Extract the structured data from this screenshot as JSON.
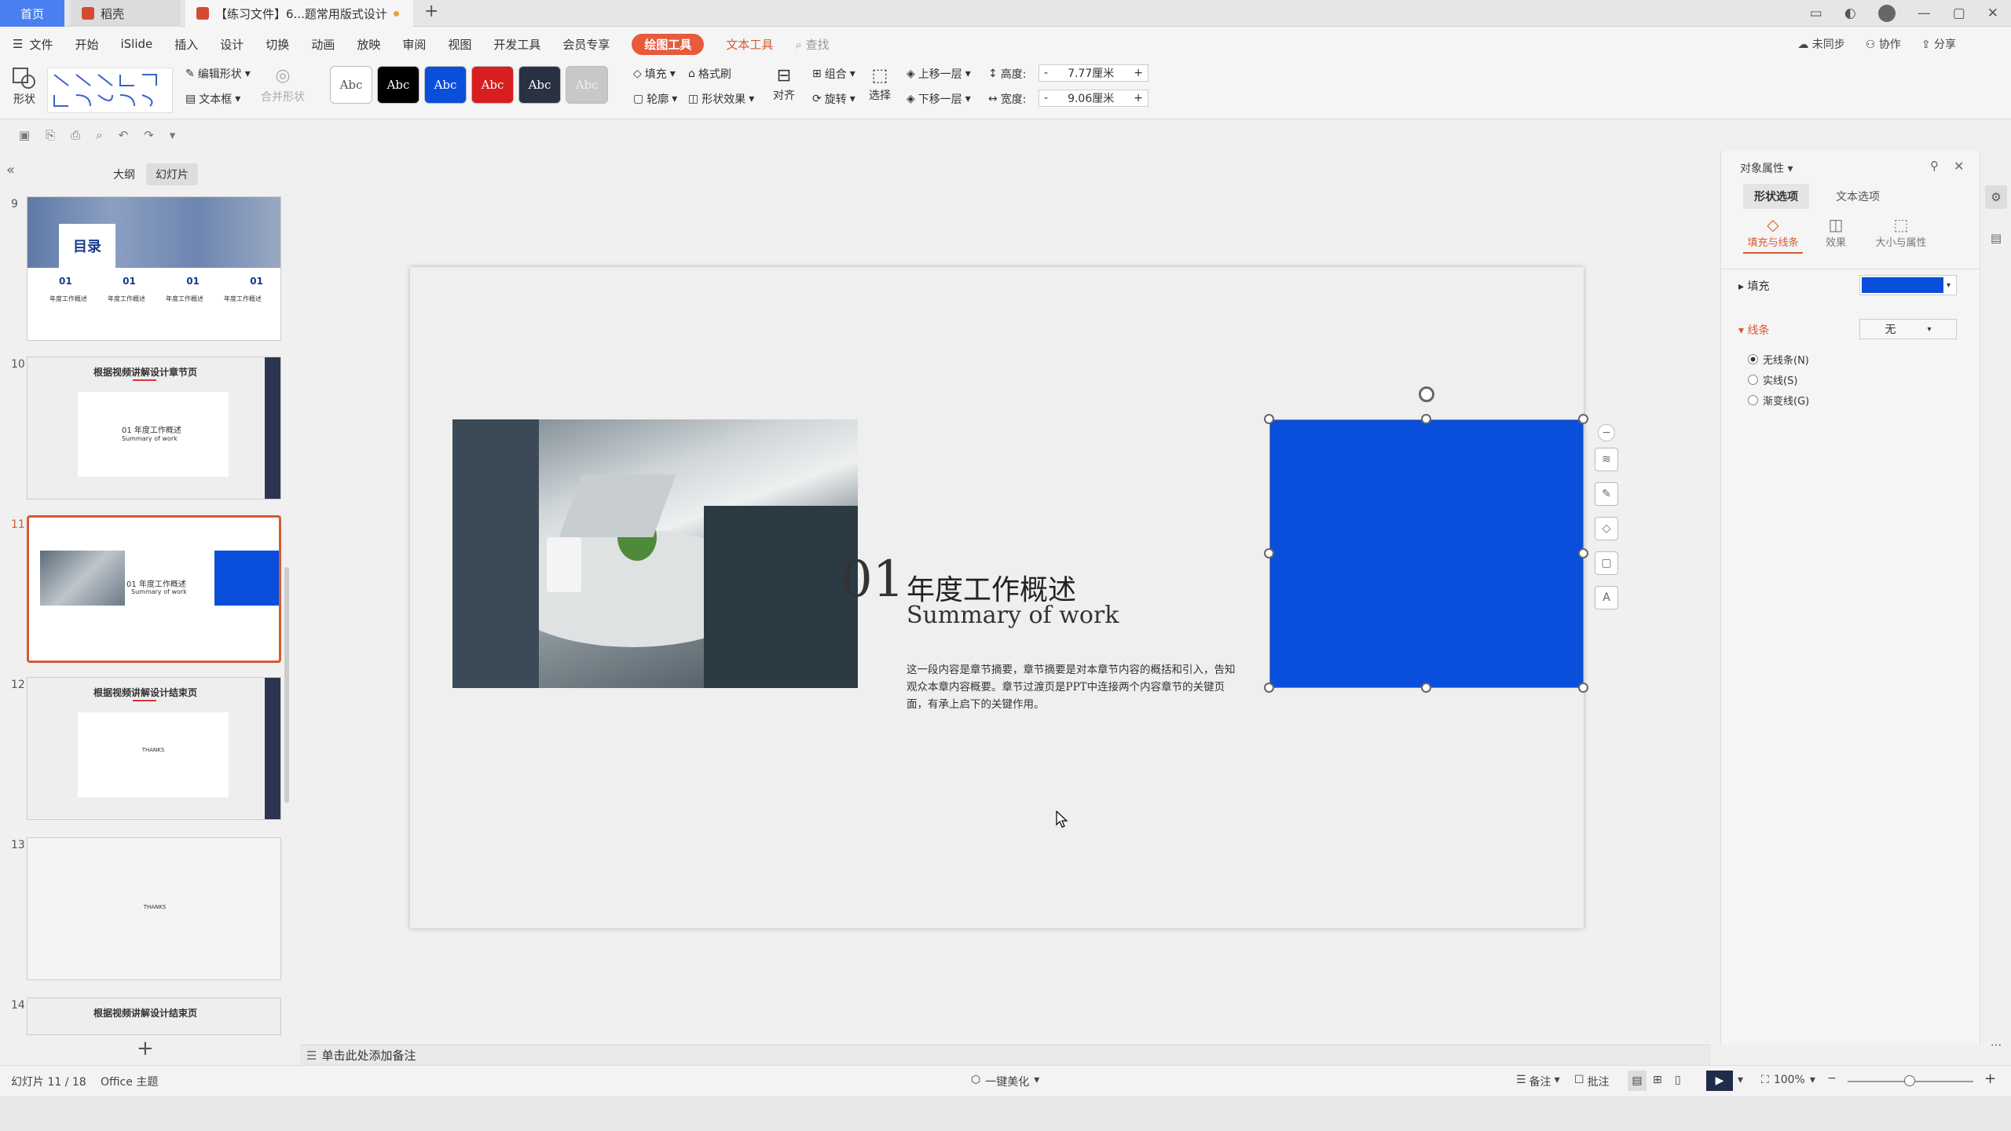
{
  "tabs": {
    "home": "首页",
    "wps": "稻壳",
    "doc": "【练习文件】6...题常用版式设计",
    "new": "+"
  },
  "menus": {
    "file": "文件",
    "items": [
      "开始",
      "iSlide",
      "插入",
      "设计",
      "切换",
      "动画",
      "放映",
      "审阅",
      "视图",
      "开发工具",
      "会员专享"
    ],
    "drawing_tools": "绘图工具",
    "text_tools": "文本工具",
    "search": "查找",
    "right": [
      "未同步",
      "协作",
      "分享"
    ]
  },
  "ribbon": {
    "shape": "形状",
    "edit_shape": "编辑形状",
    "textbox": "文本框",
    "merge_shape": "合并形状",
    "swatch_text": "Abc",
    "fill": "填充",
    "format_painter": "格式刷",
    "outline": "轮廓",
    "shape_effect": "形状效果",
    "align": "对齐",
    "group": "组合",
    "rotate": "旋转",
    "select": "选择",
    "bring_forward": "上移一层",
    "send_backward": "下移一层",
    "height_label": "高度:",
    "height_value": "7.77厘米",
    "width_label": "宽度:",
    "width_value": "9.06厘米",
    "minus": "-",
    "plus": "+"
  },
  "left_panel": {
    "outline_tab": "大纲",
    "slides_tab": "幻灯片",
    "thumbs": [
      {
        "num": "9",
        "title": "目录",
        "nums": [
          "01",
          "01",
          "01",
          "01"
        ],
        "caption": "年度工作概述"
      },
      {
        "num": "10",
        "title": "根据视频讲解设计章节页",
        "sub": "01 年度工作概述",
        "sub2": "Summary of work"
      },
      {
        "num": "11",
        "sub": "01 年度工作概述",
        "sub2": "Summary of work"
      },
      {
        "num": "12",
        "title": "根据视频讲解设计结束页",
        "sub": "THANKS"
      },
      {
        "num": "13",
        "sub": "THANKS"
      },
      {
        "num": "14",
        "title": "根据视频讲解设计结束页"
      }
    ],
    "add": "+"
  },
  "slide": {
    "number": "01",
    "title": "年度工作概述",
    "subtitle": "Summary of work",
    "body": "这一段内容是章节摘要，章节摘要是对本章节内容的概括和引入，告知观众本章内容概要。章节过渡页是PPT中连接两个内容章节的关键页面，有承上启下的关键作用。",
    "rect_color": "#0a4fdc"
  },
  "right_panel": {
    "title": "对象属性",
    "tab_shape": "形状选项",
    "tab_text": "文本选项",
    "sub_fill_line": "填充与线条",
    "sub_effect": "效果",
    "sub_size": "大小与属性",
    "fill_label": "填充",
    "fill_color": "#0a4fdc",
    "line_label": "线条",
    "line_value": "无",
    "opt_none": "无线条(N)",
    "opt_solid": "实线(S)",
    "opt_gradient": "渐变线(G)"
  },
  "notes": "单击此处添加备注",
  "status": {
    "slide_info": "幻灯片 11 / 18",
    "theme": "Office 主题",
    "beautify": "一键美化",
    "notes_btn": "备注",
    "comment_btn": "批注",
    "zoom": "100%"
  }
}
